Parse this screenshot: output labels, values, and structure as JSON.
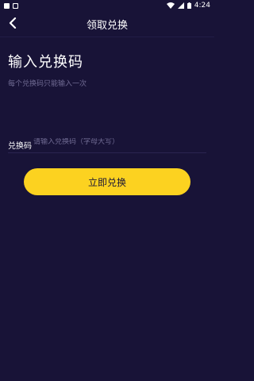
{
  "status_bar": {
    "time": "4:24"
  },
  "header": {
    "title": "领取兑换"
  },
  "main": {
    "heading": "输入兑换码",
    "hint": "每个兑换码只能输入一次",
    "code_field": {
      "label": "兑换码",
      "placeholder": "请输入兑换码（字母大写）",
      "value": ""
    },
    "redeem_button_label": "立即兑换"
  },
  "colors": {
    "background": "#181337",
    "accent": "#fcd220",
    "hint_text": "#6f6a92"
  },
  "icons": {
    "back": "chevron-left-icon",
    "wifi": "wifi-icon",
    "signal": "signal-icon",
    "battery": "battery-icon"
  }
}
